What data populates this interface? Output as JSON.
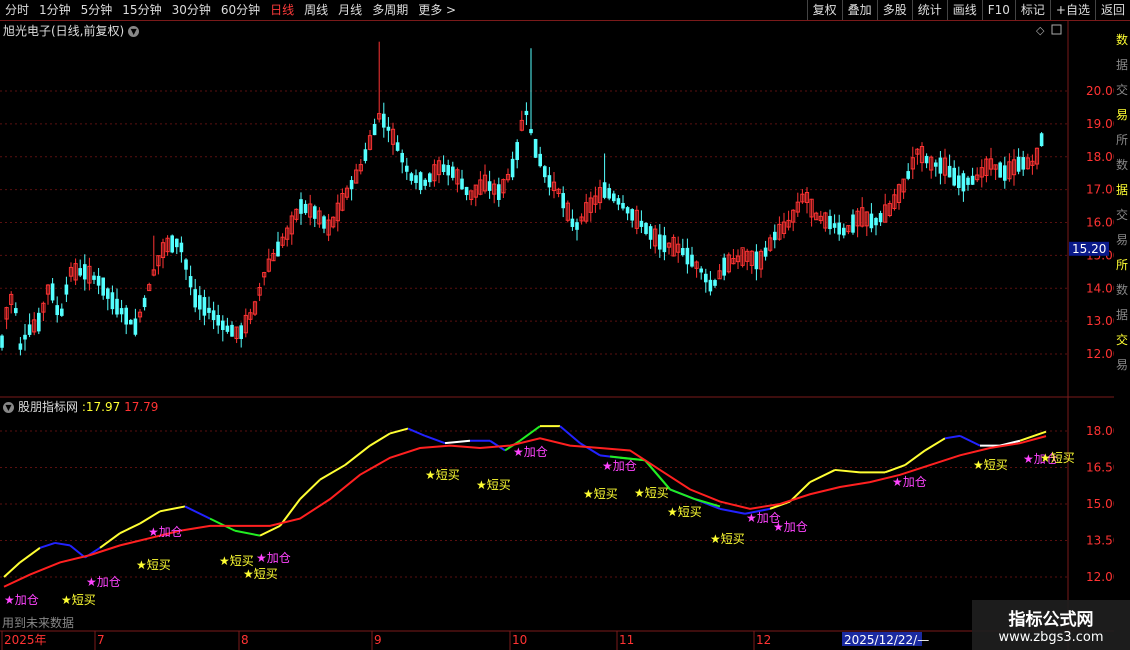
{
  "toolbar": {
    "periods": [
      {
        "label": "分时",
        "active": false
      },
      {
        "label": "1分钟",
        "active": false
      },
      {
        "label": "5分钟",
        "active": false
      },
      {
        "label": "15分钟",
        "active": false
      },
      {
        "label": "30分钟",
        "active": false
      },
      {
        "label": "60分钟",
        "active": false
      },
      {
        "label": "日线",
        "active": true
      },
      {
        "label": "周线",
        "active": false
      },
      {
        "label": "月线",
        "active": false
      },
      {
        "label": "多周期",
        "active": false
      },
      {
        "label": "更多 >",
        "active": false
      }
    ],
    "right_buttons": [
      "复权",
      "叠加",
      "多股",
      "统计",
      "画线",
      "F10",
      "标记",
      "+自选",
      "返回"
    ]
  },
  "main_chart": {
    "title": "旭光电子(日线,前复权)",
    "price_ticks": [
      "20.00",
      "19.00",
      "18.00",
      "17.00",
      "16.00",
      "15.00",
      "14.00",
      "13.00",
      "12.00"
    ],
    "current_price": "15.20"
  },
  "indicator": {
    "name": "股朋指标网",
    "value1": ":17.97",
    "value2": "17.79",
    "ticks": [
      "18.00",
      "16.50",
      "15.00",
      "13.50",
      "12.00"
    ],
    "markers": [
      {
        "type": "add",
        "text": "★加仓"
      },
      {
        "type": "short",
        "text": "★短买"
      }
    ],
    "future_note": "用到未来数据"
  },
  "date_axis": {
    "labels": [
      "2025年",
      "7",
      "8",
      "9",
      "10",
      "11",
      "12"
    ],
    "highlight": "2025/12/22/—"
  },
  "watermark": {
    "line1": "指标公式网",
    "line2": "www.zbgs3.com"
  },
  "right_strip_text": "数据交易所",
  "colors": {
    "up": "#ff3333",
    "down": "#54ffff",
    "axis": "#7a1a1a",
    "yellow": "#ffff33",
    "blue": "#2222ff",
    "green": "#22ee22",
    "red_line": "#ff2020",
    "magenta": "#ff44ff"
  }
}
